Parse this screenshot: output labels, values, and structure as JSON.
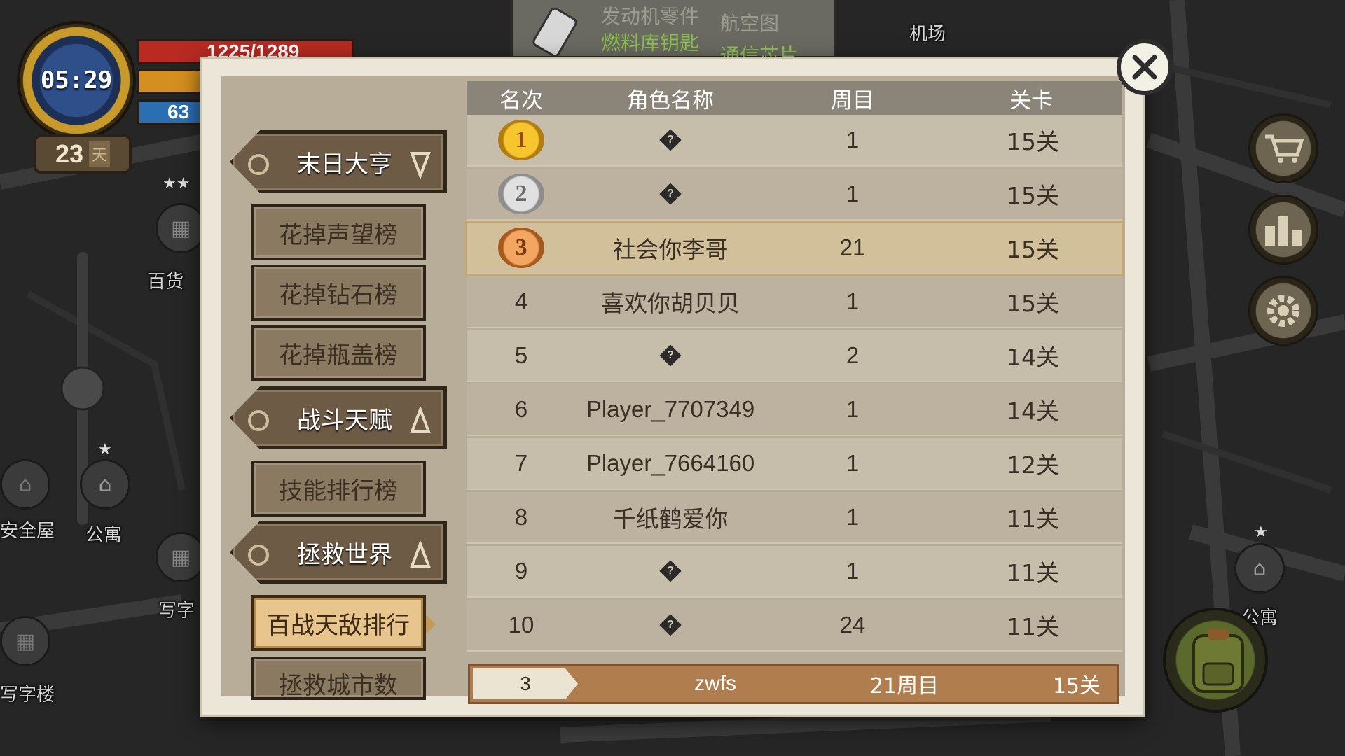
{
  "hud": {
    "time": "05:29",
    "day_count": "23",
    "day_unit": "天",
    "hp": "1225/1289",
    "water": "63"
  },
  "top_items": {
    "item1": "发动机零件",
    "item2": "燃料库钥匙",
    "item3": "航空图",
    "item4": "通信芯片"
  },
  "map": {
    "airport": "机场",
    "department_store": "百货",
    "safehouse": "安全屋",
    "apartment": "公寓",
    "office": "写字",
    "office_full": "写字楼",
    "apartment_right": "公寓"
  },
  "icons": {
    "close": "close-icon",
    "cart": "cart-icon",
    "ranking": "ranking-icon",
    "settings": "gear-icon",
    "backpack": "backpack-icon"
  },
  "menu": {
    "categories": [
      {
        "label": "末日大亨",
        "expanded": true
      },
      {
        "label": "战斗天赋",
        "expanded": false
      },
      {
        "label": "拯救世界",
        "expanded": false
      }
    ],
    "sub_items": [
      {
        "label": "花掉声望榜"
      },
      {
        "label": "花掉钻石榜"
      },
      {
        "label": "花掉瓶盖榜"
      },
      {
        "label": "技能排行榜"
      },
      {
        "label": "百战天敌排行"
      },
      {
        "label": "拯救城市数"
      }
    ],
    "active_sub": "百战天敌排行"
  },
  "table": {
    "headers": [
      "名次",
      "角色名称",
      "周目",
      "关卡"
    ],
    "rows": [
      {
        "rank": "1",
        "name": "",
        "round": "1",
        "level": "15关",
        "medal": "gold"
      },
      {
        "rank": "2",
        "name": "",
        "round": "1",
        "level": "15关",
        "medal": "silver"
      },
      {
        "rank": "3",
        "name": "社会你李哥",
        "round": "21",
        "level": "15关",
        "medal": "bronze"
      },
      {
        "rank": "4",
        "name": "喜欢你胡贝贝",
        "round": "1",
        "level": "15关"
      },
      {
        "rank": "5",
        "name": "",
        "round": "2",
        "level": "14关"
      },
      {
        "rank": "6",
        "name": "Player_7707349",
        "round": "1",
        "level": "14关"
      },
      {
        "rank": "7",
        "name": "Player_7664160",
        "round": "1",
        "level": "12关"
      },
      {
        "rank": "8",
        "name": "千纸鹤爱你",
        "round": "1",
        "level": "11关"
      },
      {
        "rank": "9",
        "name": "",
        "round": "1",
        "level": "11关"
      },
      {
        "rank": "10",
        "name": "",
        "round": "24",
        "level": "11关"
      }
    ],
    "hidden_glyph": "?"
  },
  "self": {
    "rank": "3",
    "name": "zwfs",
    "round": "21周目",
    "level": "15关"
  }
}
